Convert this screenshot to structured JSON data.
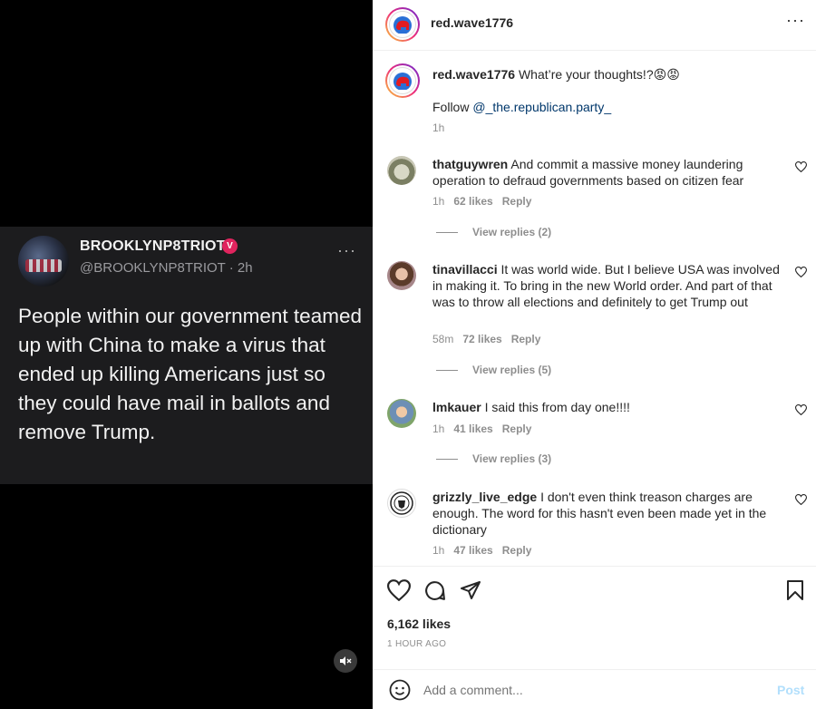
{
  "tweet": {
    "name": "BROOKLYNP8TRIOT",
    "verified_glyph": "V",
    "handle": "@BROOKLYNP8TRIOT · 2h",
    "more": "···",
    "text": "People within our government teamed up with China to make a virus that ended up killing Americans just so they could have mail in ballots and remove Trump."
  },
  "media": {
    "mute_icon": "speaker-muted-icon"
  },
  "header": {
    "username": "red.wave1776",
    "more": "···"
  },
  "caption": {
    "username": "red.wave1776",
    "text": "What’re your thoughts!?😡😡",
    "follow_prefix": "Follow ",
    "follow_link": "@_the.republican.party_",
    "time": "1h"
  },
  "comments": [
    {
      "username": "thatguywren",
      "text": "And commit a massive money laundering operation to defraud governments based on citizen fear",
      "time": "1h",
      "likes": "62 likes",
      "reply": "Reply",
      "view_replies": "View replies (2)"
    },
    {
      "username": "tinavillacci",
      "text": "It was world wide. But I believe USA was involved in making it. To bring in the new World order. And part of that was to throw all elections and definitely to get Trump out",
      "time": "58m",
      "likes": "72 likes",
      "reply": "Reply",
      "view_replies": "View replies (5)"
    },
    {
      "username": "lmkauer",
      "text": "I said this from day one!!!!",
      "time": "1h",
      "likes": "41 likes",
      "reply": "Reply",
      "view_replies": "View replies (3)"
    },
    {
      "username": "grizzly_live_edge",
      "text": "I don't even think treason charges are enough. The word for this hasn't even been made yet in the dictionary",
      "time": "1h",
      "likes": "47 likes",
      "reply": "Reply",
      "view_replies": ""
    }
  ],
  "footer": {
    "likes": "6,162 likes",
    "time_ago": "1 HOUR AGO",
    "comment_placeholder": "Add a comment...",
    "post_label": "Post"
  },
  "colors": {
    "link": "#00376b",
    "post_disabled": "#b2dffc",
    "muted_text": "#8e8e8e"
  }
}
